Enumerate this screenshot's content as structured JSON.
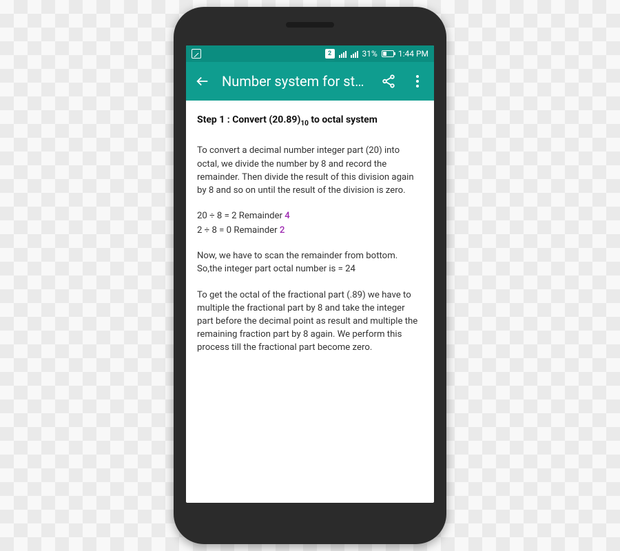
{
  "statusbar": {
    "sim_label": "2",
    "battery_text": "31%",
    "time": "1:44 PM"
  },
  "appbar": {
    "title": "Number system for st…"
  },
  "content": {
    "step_prefix": "Step 1 : Convert (20.89)",
    "step_sub": "10",
    "step_suffix": " to octal system",
    "para1": "To convert a decimal number integer part (20) into octal, we divide the number by 8 and record the remainder. Then divide the result of this division again by 8 and so on until the result of the division is zero.",
    "calc1_expr": "20 ÷ 8 = 2  Remainder  ",
    "calc1_rem": "4",
    "calc2_expr": "2 ÷ 8 = 0  Remainder  ",
    "calc2_rem": "2",
    "para2": "Now, we have to scan the remainder from bottom. So,the integer part octal number is = 24",
    "para3": "To get the octal of the fractional part (.89) we have to multiple the fractional part by 8 and take the integer part before the decimal point as result and multiple the remaining fraction part by 8 again. We perform this process till the fractional part become zero."
  },
  "colors": {
    "accent": "#0f9d8f",
    "accent_dark": "#0b8d80",
    "remainder": "#9c27b0"
  }
}
